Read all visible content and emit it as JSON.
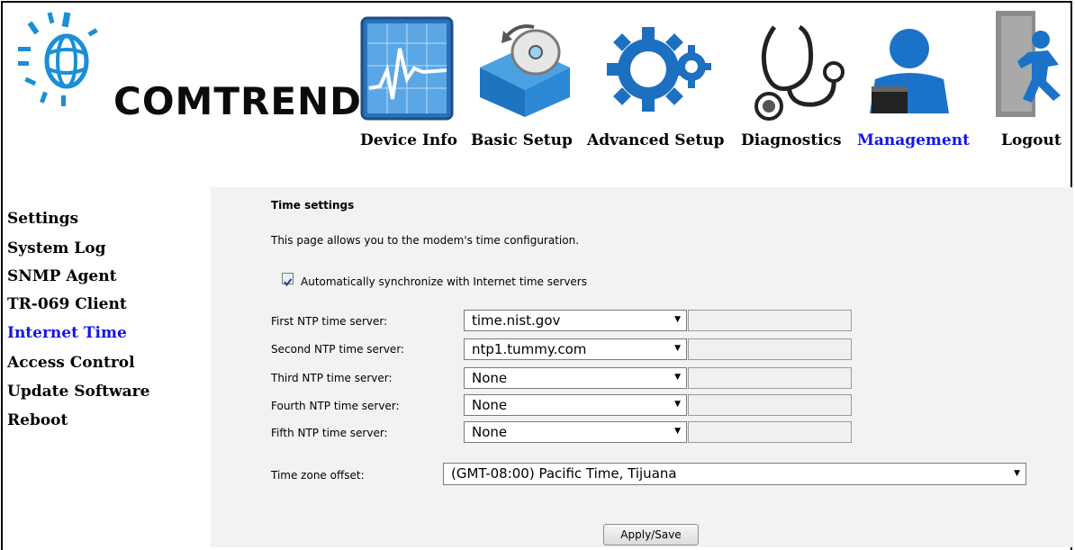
{
  "brand": {
    "name": "COMTREND"
  },
  "nav": {
    "items": [
      {
        "label": "Device Info",
        "icon": "device-info-icon"
      },
      {
        "label": "Basic Setup",
        "icon": "basic-setup-icon"
      },
      {
        "label": "Advanced Setup",
        "icon": "advanced-setup-icon"
      },
      {
        "label": "Diagnostics",
        "icon": "stethoscope-icon"
      },
      {
        "label": "Management",
        "icon": "management-icon",
        "active": true
      },
      {
        "label": "Logout",
        "icon": "logout-icon"
      }
    ]
  },
  "sidebar": {
    "items": [
      {
        "label": "Settings"
      },
      {
        "label": "System Log"
      },
      {
        "label": "SNMP Agent"
      },
      {
        "label": "TR-069 Client"
      },
      {
        "label": "Internet Time",
        "active": true
      },
      {
        "label": "Access Control"
      },
      {
        "label": "Update Software"
      },
      {
        "label": "Reboot"
      }
    ]
  },
  "page": {
    "title": "Time settings",
    "description": "This page allows you to the modem's time configuration.",
    "auto_sync": {
      "checked": true,
      "label": "Automatically synchronize with Internet time servers"
    },
    "ntp": [
      {
        "label": "First NTP time server:",
        "value": "time.nist.gov"
      },
      {
        "label": "Second NTP time server:",
        "value": "ntp1.tummy.com"
      },
      {
        "label": "Third NTP time server:",
        "value": "None"
      },
      {
        "label": "Fourth NTP time server:",
        "value": "None"
      },
      {
        "label": "Fifth NTP time server:",
        "value": "None"
      }
    ],
    "timezone": {
      "label": "Time zone offset:",
      "value": "(GMT-08:00) Pacific Time, Tijuana"
    },
    "apply_label": "Apply/Save"
  },
  "colors": {
    "active_link": "#1515e6",
    "panel_bg": "#f2f2f2"
  }
}
